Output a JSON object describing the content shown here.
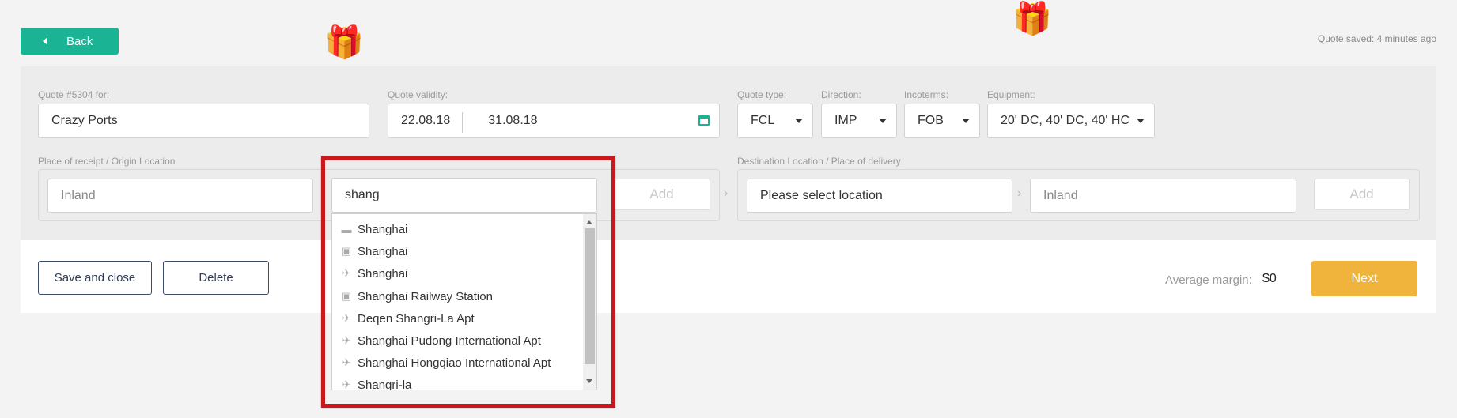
{
  "header": {
    "back_label": "Back",
    "saved_text": "Quote saved: 4 minutes ago"
  },
  "quote": {
    "for_label": "Quote #5304 for:",
    "client": "Crazy Ports",
    "validity_label": "Quote validity:",
    "valid_from": "22.08.18",
    "valid_to": "31.08.18",
    "type_label": "Quote type:",
    "type_value": "FCL",
    "direction_label": "Direction:",
    "direction_value": "IMP",
    "incoterms_label": "Incoterms:",
    "incoterms_value": "FOB",
    "equipment_label": "Equipment:",
    "equipment_value": "20' DC, 40' DC, 40' HC"
  },
  "origin": {
    "label": "Place of receipt / Origin Location",
    "inland_placeholder": "Inland",
    "search_value": "shang",
    "add_label": "Add"
  },
  "destination": {
    "label": "Destination Location / Place of delivery",
    "location_placeholder": "Please select location",
    "inland_placeholder": "Inland",
    "add_label": "Add"
  },
  "dropdown": {
    "items": [
      {
        "icon": "ship-icon",
        "label": "Shanghai"
      },
      {
        "icon": "train-icon",
        "label": "Shanghai"
      },
      {
        "icon": "plane-icon",
        "label": "Shanghai"
      },
      {
        "icon": "train-icon",
        "label": "Shanghai Railway Station"
      },
      {
        "icon": "plane-icon",
        "label": "Deqen Shangri-La Apt"
      },
      {
        "icon": "plane-icon",
        "label": "Shanghai Pudong International Apt"
      },
      {
        "icon": "plane-icon",
        "label": "Shanghai Hongqiao International Apt"
      },
      {
        "icon": "plane-icon",
        "label": "Shangri-la"
      }
    ]
  },
  "footer": {
    "save_close_label": "Save and close",
    "delete_label": "Delete",
    "avg_margin_label": "Average margin:",
    "avg_margin_value": "$0",
    "next_label": "Next"
  },
  "colors": {
    "accent": "#1ab394",
    "next": "#f0b43c",
    "highlight": "#c8181e"
  }
}
